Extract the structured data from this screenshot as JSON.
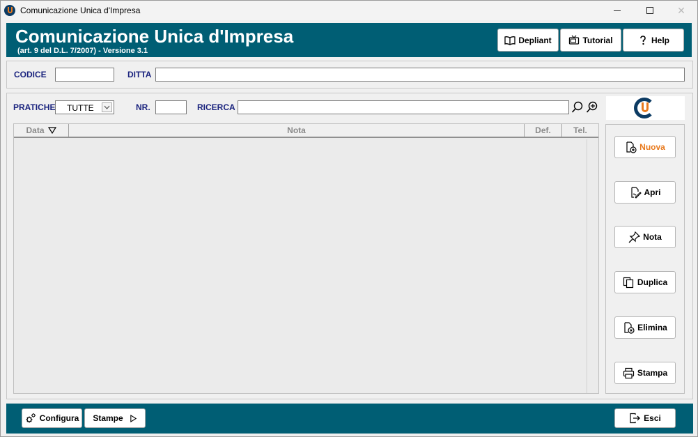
{
  "window": {
    "title": "Comunicazione Unica d'Impresa",
    "close_glyph": "✕"
  },
  "header": {
    "title": "Comunicazione Unica d'Impresa",
    "subtitle": "(art. 9 del D.L. 7/2007) - Versione 3.1",
    "buttons": {
      "depliant": "Depliant",
      "tutorial": "Tutorial",
      "help": "Help"
    }
  },
  "filters": {
    "codice_label": "CODICE",
    "codice_value": "",
    "ditta_label": "DITTA",
    "ditta_value": "",
    "pratiche_label": "PRATICHE",
    "pratiche_value": "TUTTE",
    "nr_label": "NR.",
    "nr_value": "",
    "ricerca_label": "RICERCA",
    "ricerca_value": ""
  },
  "table": {
    "columns": {
      "data": "Data",
      "nota": "Nota",
      "def": "Def.",
      "tel": "Tel."
    },
    "rows": []
  },
  "actions": {
    "nuova": "Nuova",
    "apri": "Apri",
    "nota": "Nota",
    "duplica": "Duplica",
    "elimina": "Elimina",
    "stampa": "Stampa"
  },
  "footer": {
    "configura": "Configura",
    "stampe": "Stampe",
    "esci": "Esci"
  },
  "colors": {
    "band": "#005e74",
    "label": "#1a237e",
    "accent": "#e87a1e",
    "logo_blue": "#0c3b63"
  }
}
